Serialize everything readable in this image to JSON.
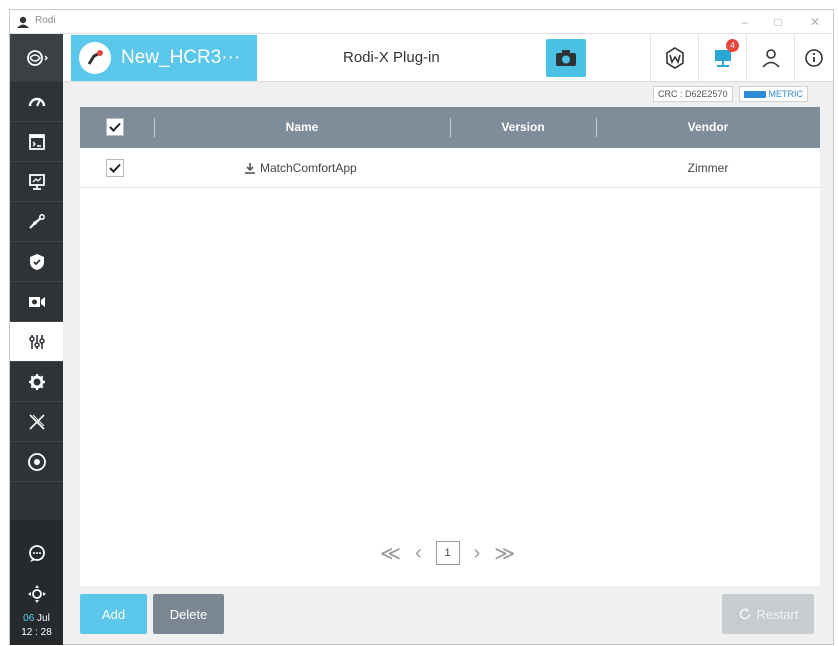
{
  "window": {
    "title": "Rodi",
    "minimize": "–",
    "maximize": "□",
    "close": "✕"
  },
  "header": {
    "robot_name": "New_HCR3···",
    "plugin_title": "Rodi-X Plug-in",
    "notification_count": "4",
    "accent_color": "#5bc7ea"
  },
  "status": {
    "crc": "CRC : D62E2570",
    "unit": "METRIC"
  },
  "sidebar": {
    "items": [
      {
        "icon": "gauge-icon"
      },
      {
        "icon": "terminal-icon"
      },
      {
        "icon": "monitor-icon"
      },
      {
        "icon": "robot-arm-icon"
      },
      {
        "icon": "shield-icon"
      },
      {
        "icon": "camera-icon"
      },
      {
        "icon": "sliders-icon",
        "active": true
      },
      {
        "icon": "gear-icon"
      },
      {
        "icon": "x-logo-icon"
      },
      {
        "icon": "disc-icon"
      }
    ],
    "date": {
      "day": "06",
      "month": "Jul",
      "time": "12 : 28"
    }
  },
  "table": {
    "columns": [
      "Name",
      "Version",
      "Vendor"
    ],
    "rows": [
      {
        "name": "MatchComfortApp",
        "version": "",
        "vendor": "Zimmer",
        "checked": true
      }
    ]
  },
  "pagination": {
    "current": "1",
    "first": "≪",
    "prev": "‹",
    "next": "›",
    "last": "≫"
  },
  "buttons": {
    "add": "Add",
    "delete": "Delete",
    "restart": "Restart"
  }
}
